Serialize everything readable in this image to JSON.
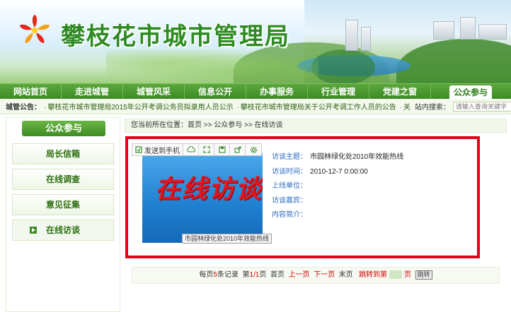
{
  "header": {
    "site_title": "攀枝花市城市管理局"
  },
  "nav": {
    "items": [
      "网站首页",
      "走进城管",
      "城管风采",
      "信息公开",
      "办事服务",
      "行业管理",
      "党建之窗"
    ],
    "active": "公众参与"
  },
  "notice": {
    "label": "城管公告：",
    "item1": "攀枝花市城市管理局2015年公开考调公务员拟录用人员公示",
    "item2": "攀枝花市城市管理局关于公开考调工作人员的公告",
    "item3": "关",
    "search_label": "站内搜索：",
    "search_placeholder": "请输入查询关键字"
  },
  "sidebar": {
    "title": "公众参与",
    "items": [
      "局长信箱",
      "在线调查",
      "意见征集",
      "在线访谈"
    ],
    "active_index": 3
  },
  "breadcrumb": {
    "text": "您当前所在位置：首页 >> 公众参与 >> 在线访谈"
  },
  "interview": {
    "thumb_title": "在线访谈",
    "thumb_caption": "市园林绿化处2010年效能热线",
    "send_label": "发送到手机",
    "fields": [
      {
        "key": "访谈主题：",
        "value": "市园林绿化处2010年效能热线"
      },
      {
        "key": "访谈时间：",
        "value": "2010-12-7 0:00:00"
      },
      {
        "key": "上线单位：",
        "value": ""
      },
      {
        "key": "访谈嘉宾：",
        "value": ""
      },
      {
        "key": "内容简介：",
        "value": ""
      }
    ]
  },
  "pager": {
    "per_page_prefix": "每页",
    "per_page": "5",
    "per_page_suffix": "条记录",
    "page_prefix": "第",
    "page_info": "1/1",
    "page_suffix": "页",
    "first": "首页",
    "prev": "上一页",
    "next": "下一页",
    "last": "末页",
    "jump_label": "跳转到第",
    "page_unit": "页",
    "jump_button": "跳转"
  },
  "colors": {
    "brand_green": "#3e8d24",
    "highlight_red": "#e0001a",
    "link_blue": "#2b6bbf"
  }
}
